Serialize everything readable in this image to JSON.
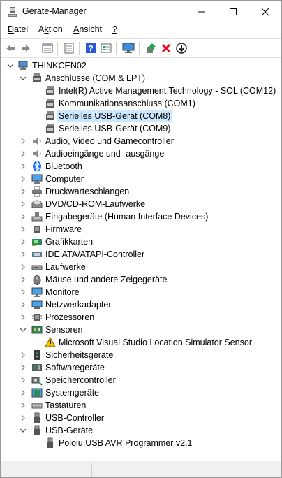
{
  "window": {
    "title": "Geräte-Manager"
  },
  "title_buttons": {
    "minimize": "—",
    "maximize": "☐",
    "close": "✕"
  },
  "menu": [
    {
      "label": "Datei",
      "accel": "D",
      "rest": "atei"
    },
    {
      "label": "Aktion",
      "accel": "k",
      "pre": "A",
      "rest": "tion"
    },
    {
      "label": "Ansicht",
      "accel": "A",
      "rest": "nsicht"
    },
    {
      "label": "?",
      "accel": "?",
      "rest": ""
    }
  ],
  "toolbar": [
    "back-icon",
    "forward-icon",
    "properties-sheet-icon",
    "device-list-icon",
    "help-icon",
    "action-list-icon",
    "monitor-scan-icon",
    "update-driver-icon",
    "uninstall-icon",
    "disable-device-icon"
  ],
  "tree": {
    "root": "THINKCEN02",
    "categories": [
      {
        "label": "Anschlüsse (COM & LPT)",
        "icon": "port-icon",
        "expanded": true,
        "children": [
          "Intel(R) Active Management Technology - SOL (COM12)",
          "Kommunikationsanschluss (COM1)",
          "Serielles USB-Gerät (COM8)",
          "Serielles USB-Gerät (COM9)"
        ],
        "selected_child": 2
      },
      {
        "label": "Audio, Video und Gamecontroller",
        "icon": "speaker-icon"
      },
      {
        "label": "Audioeingänge und -ausgänge",
        "icon": "speaker-icon"
      },
      {
        "label": "Bluetooth",
        "icon": "bluetooth-icon"
      },
      {
        "label": "Computer",
        "icon": "computer-icon"
      },
      {
        "label": "Druckwarteschlangen",
        "icon": "printer-icon"
      },
      {
        "label": "DVD/CD-ROM-Laufwerke",
        "icon": "dvd-drive-icon"
      },
      {
        "label": "Eingabegeräte (Human Interface Devices)",
        "icon": "hid-icon"
      },
      {
        "label": "Firmware",
        "icon": "firmware-icon"
      },
      {
        "label": "Grafikkarten",
        "icon": "display-adapter-icon"
      },
      {
        "label": "IDE ATA/ATAPI-Controller",
        "icon": "ide-controller-icon"
      },
      {
        "label": "Laufwerke",
        "icon": "disk-drive-icon"
      },
      {
        "label": "Mäuse und andere Zeigegeräte",
        "icon": "mouse-icon"
      },
      {
        "label": "Monitore",
        "icon": "monitor-icon"
      },
      {
        "label": "Netzwerkadapter",
        "icon": "network-adapter-icon"
      },
      {
        "label": "Prozessoren",
        "icon": "processor-icon"
      },
      {
        "label": "Sensoren",
        "icon": "sensor-icon",
        "expanded": true,
        "children": [
          "Microsoft Visual Studio Location Simulator Sensor"
        ],
        "child_icon": "warning-icon"
      },
      {
        "label": "Sicherheitsgeräte",
        "icon": "security-device-icon"
      },
      {
        "label": "Softwaregeräte",
        "icon": "software-device-icon"
      },
      {
        "label": "Speichercontroller",
        "icon": "storage-controller-icon"
      },
      {
        "label": "Systemgeräte",
        "icon": "system-device-icon"
      },
      {
        "label": "Tastaturen",
        "icon": "keyboard-icon"
      },
      {
        "label": "USB-Controller",
        "icon": "usb-controller-icon"
      },
      {
        "label": "USB-Geräte",
        "icon": "usb-device-icon",
        "expanded": true,
        "children": [
          "Pololu USB AVR Programmer v2.1"
        ],
        "child_icon": "usb-plug-icon"
      }
    ]
  },
  "colors": {
    "selection": "#cce8ff",
    "accent": "#1a73e8",
    "error": "#e81123",
    "success": "#1aa94b"
  }
}
